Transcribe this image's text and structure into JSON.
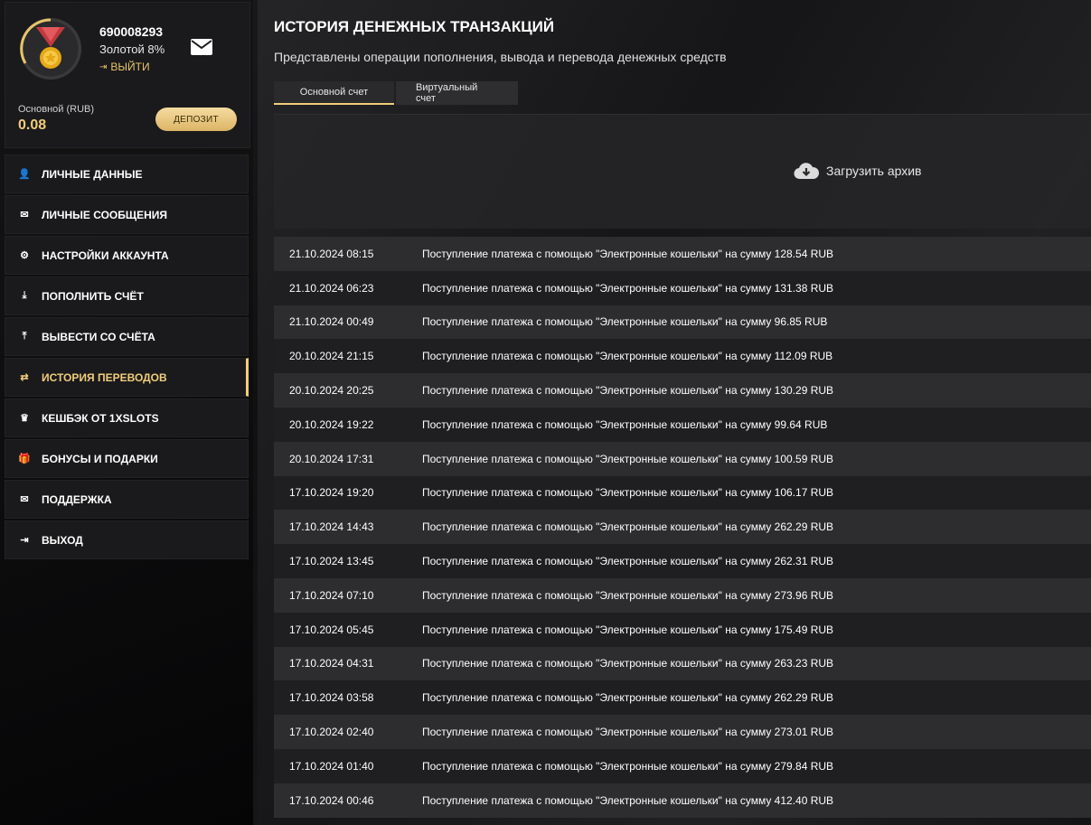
{
  "profile": {
    "user_id": "690008293",
    "level": "Золотой 8%",
    "logout_label": "ВЫЙТИ",
    "balance_label": "Основной (RUB)",
    "balance_value": "0.08",
    "deposit_label": "ДЕПОЗИТ"
  },
  "sidebar": {
    "items": [
      {
        "label": "ЛИЧНЫЕ ДАННЫЕ",
        "icon": "user-plus-icon",
        "glyph": "👤"
      },
      {
        "label": "ЛИЧНЫЕ СООБЩЕНИЯ",
        "icon": "envelope-icon",
        "glyph": "✉"
      },
      {
        "label": "НАСТРОЙКИ АККАУНТА",
        "icon": "gears-icon",
        "glyph": "⚙"
      },
      {
        "label": "ПОПОЛНИТЬ СЧЁТ",
        "icon": "download-icon",
        "glyph": "⤓"
      },
      {
        "label": "ВЫВЕСТИ СО СЧЁТА",
        "icon": "upload-icon",
        "glyph": "⤒"
      },
      {
        "label": "ИСТОРИЯ ПЕРЕВОДОВ",
        "icon": "exchange-icon",
        "glyph": "⇄"
      },
      {
        "label": "КЕШБЭК ОТ 1XSLOTS",
        "icon": "crown-icon",
        "glyph": "♛"
      },
      {
        "label": "БОНУСЫ И ПОДАРКИ",
        "icon": "gift-icon",
        "glyph": "🎁"
      },
      {
        "label": "ПОДДЕРЖКА",
        "icon": "envelope-icon",
        "glyph": "✉"
      },
      {
        "label": "ВЫХОД",
        "icon": "sign-out-icon",
        "glyph": "⇥"
      }
    ],
    "active_index": 5
  },
  "main": {
    "title": "ИСТОРИЯ ДЕНЕЖНЫХ ТРАНЗАКЦИЙ",
    "subtitle": "Представлены операции пополнения, вывода и перевода денежных средств",
    "tabs": [
      {
        "label": "Основной счет"
      },
      {
        "label": "Виртуальный счет"
      }
    ],
    "archive_label": "Загрузить архив"
  },
  "transactions": [
    {
      "date": "21.10.2024 08:15",
      "text": "Поступление платежа с помощью \"Электронные кошельки\" на сумму 128.54 RUB"
    },
    {
      "date": "21.10.2024 06:23",
      "text": "Поступление платежа с помощью \"Электронные кошельки\" на сумму 131.38 RUB"
    },
    {
      "date": "21.10.2024 00:49",
      "text": "Поступление платежа с помощью \"Электронные кошельки\" на сумму 96.85 RUB"
    },
    {
      "date": "20.10.2024 21:15",
      "text": "Поступление платежа с помощью \"Электронные кошельки\" на сумму 112.09 RUB"
    },
    {
      "date": "20.10.2024 20:25",
      "text": "Поступление платежа с помощью \"Электронные кошельки\" на сумму 130.29 RUB"
    },
    {
      "date": "20.10.2024 19:22",
      "text": "Поступление платежа с помощью \"Электронные кошельки\" на сумму 99.64 RUB"
    },
    {
      "date": "20.10.2024 17:31",
      "text": "Поступление платежа с помощью \"Электронные кошельки\" на сумму 100.59 RUB"
    },
    {
      "date": "17.10.2024 19:20",
      "text": "Поступление платежа с помощью \"Электронные кошельки\" на сумму 106.17 RUB"
    },
    {
      "date": "17.10.2024 14:43",
      "text": "Поступление платежа с помощью \"Электронные кошельки\" на сумму 262.29 RUB"
    },
    {
      "date": "17.10.2024 13:45",
      "text": "Поступление платежа с помощью \"Электронные кошельки\" на сумму 262.31 RUB"
    },
    {
      "date": "17.10.2024 07:10",
      "text": "Поступление платежа с помощью \"Электронные кошельки\" на сумму 273.96 RUB"
    },
    {
      "date": "17.10.2024 05:45",
      "text": "Поступление платежа с помощью \"Электронные кошельки\" на сумму 175.49 RUB"
    },
    {
      "date": "17.10.2024 04:31",
      "text": "Поступление платежа с помощью \"Электронные кошельки\" на сумму 263.23 RUB"
    },
    {
      "date": "17.10.2024 03:58",
      "text": "Поступление платежа с помощью \"Электронные кошельки\" на сумму 262.29 RUB"
    },
    {
      "date": "17.10.2024 02:40",
      "text": "Поступление платежа с помощью \"Электронные кошельки\" на сумму 273.01 RUB"
    },
    {
      "date": "17.10.2024 01:40",
      "text": "Поступление платежа с помощью \"Электронные кошельки\" на сумму 279.84 RUB"
    },
    {
      "date": "17.10.2024 00:46",
      "text": "Поступление платежа с помощью \"Электронные кошельки\" на сумму 412.40 RUB"
    }
  ],
  "colors": {
    "accent": "#f1cd7b",
    "panel": "#1a1a1c",
    "background": "#111112"
  }
}
